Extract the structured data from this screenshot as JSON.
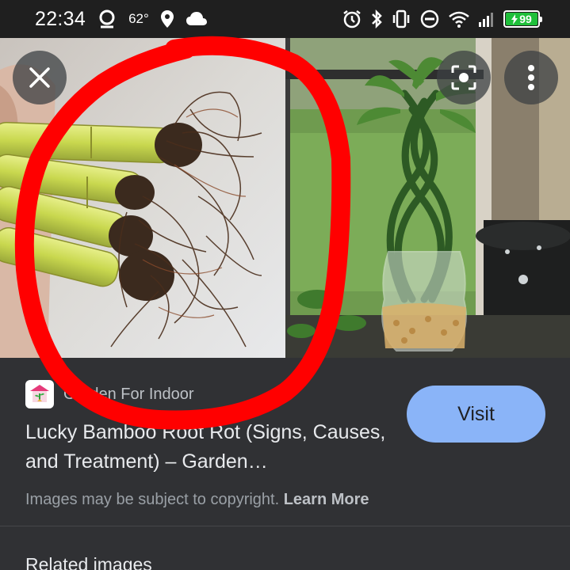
{
  "status_bar": {
    "time": "22:34",
    "temperature": "62°",
    "battery": "99",
    "icons": [
      "timer-person-icon",
      "location-pin-icon",
      "cloud-icon",
      "alarm-icon",
      "bluetooth-icon",
      "vibrate-icon",
      "do-not-disturb-icon",
      "wifi-icon",
      "signal-icon",
      "battery-charging-icon"
    ]
  },
  "image_viewer": {
    "close_icon": "close-icon",
    "lens_icon": "lens-icon",
    "more_icon": "more-vert-icon",
    "annotation_color": "#ff0000"
  },
  "result": {
    "source": "Garden For Indoor",
    "title": "Lucky Bamboo Root Rot (Signs, Causes, and Treatment) – Garden…",
    "visit_label": "Visit",
    "copyright_text": "Images may be subject to copyright.",
    "learn_more_label": "Learn More",
    "related_heading": "Related images"
  },
  "colors": {
    "background": "#303134",
    "status_bar": "#1f1f1f",
    "visit_button": "#8ab4f8",
    "battery": "#1fbf3a"
  }
}
